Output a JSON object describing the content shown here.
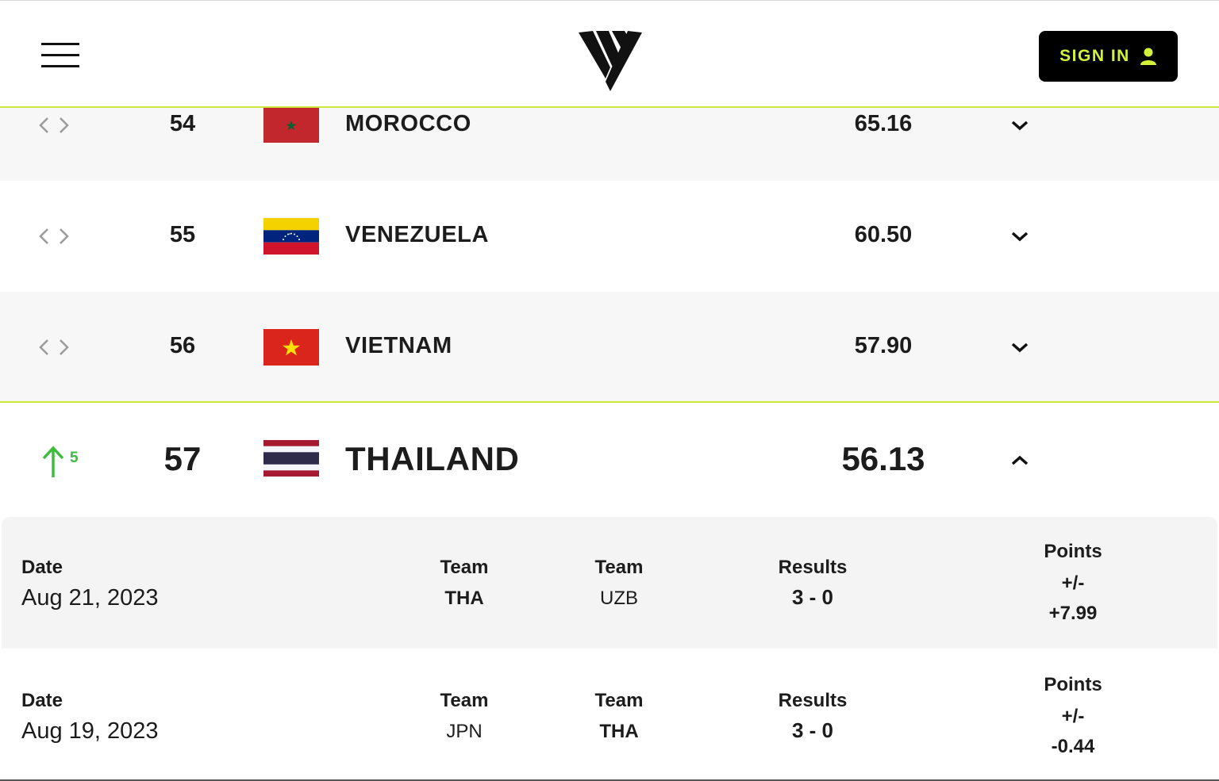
{
  "header": {
    "signin_label": "SIGN IN",
    "accent_color": "#d4f23a"
  },
  "rankings": [
    {
      "rank": "54",
      "country": "MOROCCO",
      "points": "65.16",
      "flag": "morocco-flag",
      "movement": "none"
    },
    {
      "rank": "55",
      "country": "VENEZUELA",
      "points": "60.50",
      "flag": "venezuela-flag",
      "movement": "none"
    },
    {
      "rank": "56",
      "country": "VIETNAM",
      "points": "57.90",
      "flag": "vietnam-flag",
      "movement": "none"
    },
    {
      "rank": "57",
      "country": "THAILAND",
      "points": "56.13",
      "flag": "thailand-flag",
      "movement": "up",
      "movement_count": "5",
      "expanded": true
    }
  ],
  "matches": [
    {
      "date_label": "Date",
      "date": "Aug 21, 2023",
      "team1_label": "Team",
      "team1": "THA",
      "team2_label": "Team",
      "team2": "UZB",
      "results_label": "Results",
      "results": "3 - 0",
      "points_label": "Points",
      "points_pm": "+/-",
      "points_change": "+7.99"
    },
    {
      "date_label": "Date",
      "date": "Aug 19, 2023",
      "team1_label": "Team",
      "team1": "JPN",
      "team2_label": "Team",
      "team2": "THA",
      "results_label": "Results",
      "results": "3 - 0",
      "points_label": "Points",
      "points_pm": "+/-",
      "points_change": "-0.44"
    }
  ]
}
